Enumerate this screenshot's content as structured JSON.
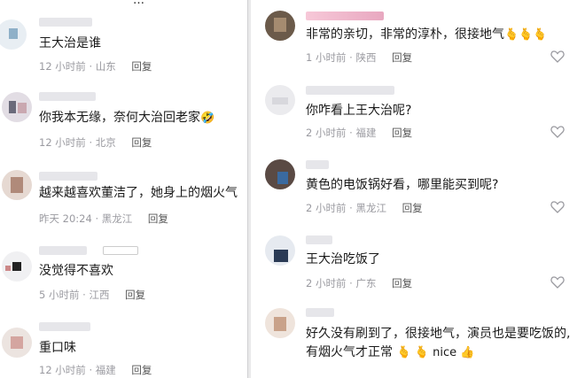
{
  "left": {
    "top_cut_text": "…",
    "comments": [
      {
        "text": "王大治是谁",
        "time": "12 小时前",
        "loc": "山东",
        "reply": "回复"
      },
      {
        "text": "你我本无缘，奈何大治回老家",
        "emoji": "🤣",
        "time": "12 小时前",
        "loc": "北京",
        "reply": "回复"
      },
      {
        "text": "越来越喜欢董洁了，她身上的烟火气",
        "time": "昨天 20:24",
        "loc": "黑龙江",
        "reply": "回复"
      },
      {
        "text": "没觉得不喜欢",
        "time": "5 小时前",
        "loc": "江西",
        "reply": "回复"
      },
      {
        "text": "重口味",
        "time": "12 小时前",
        "loc": "福建",
        "reply": "回复"
      }
    ]
  },
  "right": {
    "comments": [
      {
        "text": "非常的亲切，非常的淳朴，很接地气",
        "emoji": "🫰🫰🫰",
        "time": "1 小时前",
        "loc": "陕西",
        "reply": "回复"
      },
      {
        "text": "你咋看上王大治呢?",
        "time": "2 小时前",
        "loc": "福建",
        "reply": "回复"
      },
      {
        "text": "黄色的电饭锅好看，哪里能买到呢?",
        "time": "2 小时前",
        "loc": "黑龙江",
        "reply": "回复"
      },
      {
        "text": "王大治吃饭了",
        "time": "2 小时前",
        "loc": "广东",
        "reply": "回复"
      },
      {
        "text": "好久没有刷到了，很接地气，演员也是要吃饭的,",
        "text2": "有烟火气才正常",
        "emoji2": "🫰 🫰 nice 👍"
      }
    ]
  },
  "colors": {
    "meta": "#9a9aa0",
    "heart_outline": "#9a9aa0"
  }
}
